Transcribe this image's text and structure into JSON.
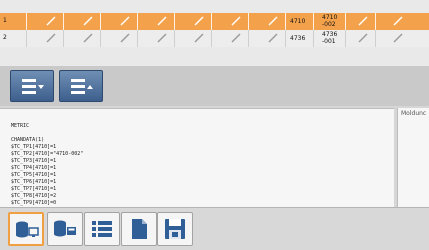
{
  "grid": {
    "rows": [
      {
        "index": "1",
        "value_a": "4710",
        "value_b_line1": "4710",
        "value_b_line2": "-002",
        "selected": true
      },
      {
        "index": "2",
        "value_a": "4736",
        "value_b_line1": "4736",
        "value_b_line2": "-001",
        "selected": false
      }
    ]
  },
  "text_panel": {
    "lines": [
      "METRIC",
      "",
      "CHANDATA(1)",
      "$TC_TP1[4710]=1",
      "$TC_TP2[4710]=\"4710-002\"",
      "$TC_TP3[4710]=1",
      "$TC_TP4[4710]=1",
      "$TC_TP5[4710]=1",
      "$TC_TP6[4710]=1",
      "$TC_TP7[4710]=1",
      "$TC_TP8[4710]=2",
      "$TC_TP9[4710]=0"
    ]
  },
  "side_panel": {
    "title": "Moldunc"
  },
  "colors": {
    "selected_row": "#f4a14c",
    "toolbar_blue": "#3d5f8d",
    "active_border": "#f0a040"
  },
  "icons": {
    "toolbar": [
      "list-dropdown-icon",
      "list-sort-up-icon"
    ],
    "bottom": [
      "database-monitor-icon",
      "database-card-icon",
      "list-icon",
      "document-icon",
      "save-disk-icon"
    ]
  }
}
